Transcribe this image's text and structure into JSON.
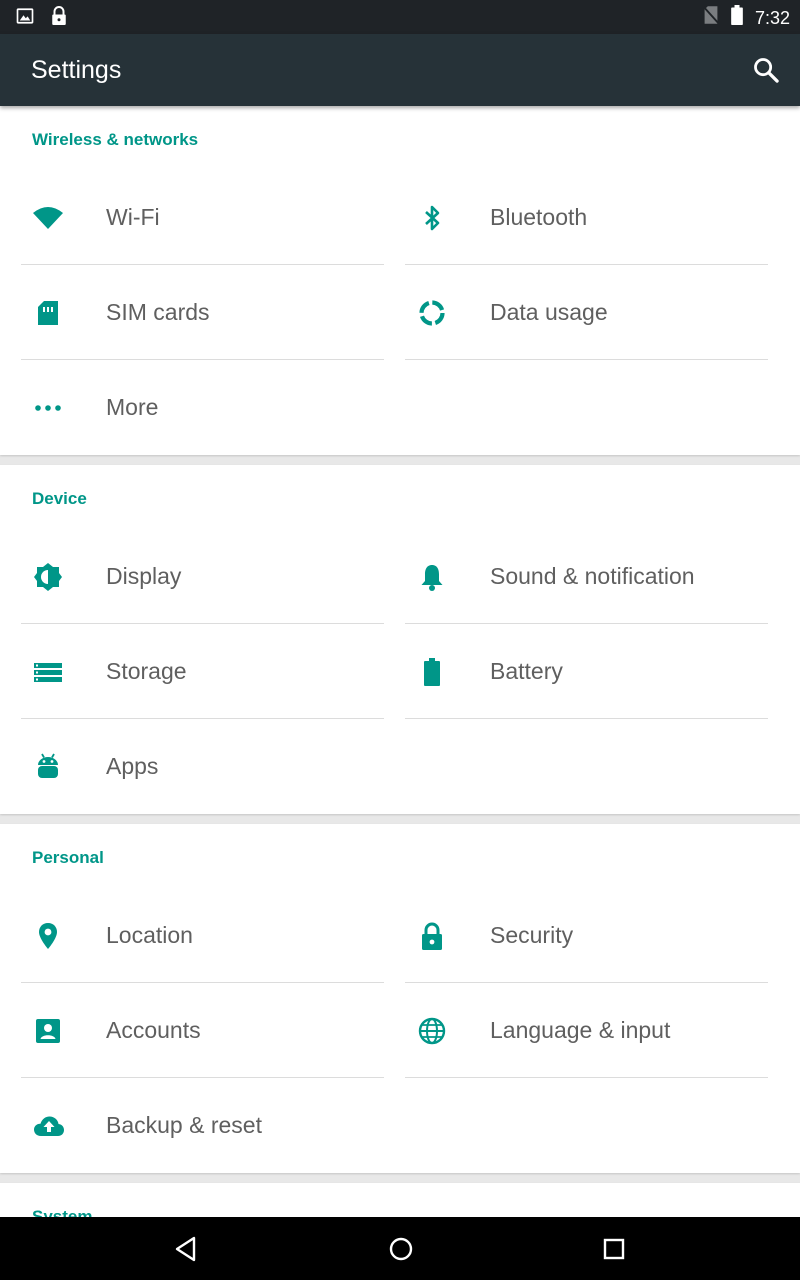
{
  "status_bar": {
    "time": "7:32",
    "left_icons": [
      "gallery-icon",
      "lock-icon"
    ],
    "right_icons": [
      "no-sim-icon",
      "battery-icon"
    ]
  },
  "app_bar": {
    "title": "Settings",
    "action_icon": "search-icon"
  },
  "colors": {
    "accent": "#009688",
    "app_bar": "#263238",
    "status_bar": "#1f2327",
    "text": "#5f5f5f"
  },
  "sections": [
    {
      "header": "Wireless & networks",
      "items": [
        {
          "label": "Wi-Fi",
          "icon": "wifi-icon"
        },
        {
          "label": "Bluetooth",
          "icon": "bluetooth-icon"
        },
        {
          "label": "SIM cards",
          "icon": "sim-card-icon"
        },
        {
          "label": "Data usage",
          "icon": "data-usage-icon"
        },
        {
          "label": "More",
          "icon": "more-icon"
        }
      ]
    },
    {
      "header": "Device",
      "items": [
        {
          "label": "Display",
          "icon": "brightness-icon"
        },
        {
          "label": "Sound & notification",
          "icon": "bell-icon"
        },
        {
          "label": "Storage",
          "icon": "storage-icon"
        },
        {
          "label": "Battery",
          "icon": "battery-icon"
        },
        {
          "label": "Apps",
          "icon": "android-icon"
        }
      ]
    },
    {
      "header": "Personal",
      "items": [
        {
          "label": "Location",
          "icon": "location-pin-icon"
        },
        {
          "label": "Security",
          "icon": "lock-icon"
        },
        {
          "label": "Accounts",
          "icon": "account-box-icon"
        },
        {
          "label": "Language & input",
          "icon": "globe-icon"
        },
        {
          "label": "Backup & reset",
          "icon": "cloud-upload-icon"
        }
      ]
    },
    {
      "header": "System",
      "items": []
    }
  ],
  "nav_bar": {
    "icons": [
      "back-icon",
      "home-icon",
      "recents-icon"
    ]
  }
}
